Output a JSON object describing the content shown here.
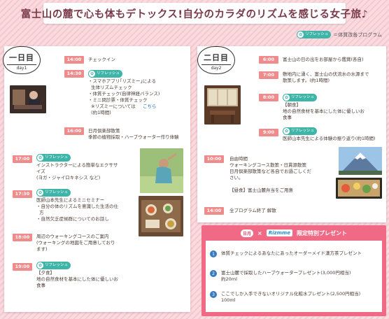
{
  "banner": {
    "title": "富士山の麓で心も体もデトックス!自分のカラダのリズムを感じる女子旅♪"
  },
  "legend": {
    "tag_text": "リフレッシュ",
    "text": "＝体質改善プログラム"
  },
  "colors": {
    "time_badge": "#f08b8b",
    "tag": "#3fb4a8",
    "present": "#f06a85",
    "link": "#1a6fc4"
  },
  "day1": {
    "badge": {
      "title": "一日目",
      "subtitle": "day1"
    },
    "items": [
      {
        "time": "14:00",
        "text": "チェックイン"
      },
      {
        "time": "14:30",
        "tag": "リフレッシュ",
        "text": "・スマホアプリ｢リズミー｣による\n  生体リズムチェック\n・体質チェック(自律神経バランス)\n・ミニ問診票・体質チェック\n  ※リズミーについては",
        "link": "こちら",
        "after": "  (約1時間)"
      },
      {
        "time": "16:00",
        "text": "日月倶楽部散策\n季節の植物採取・ハーブウォーター作り体験"
      },
      {
        "time": "17:00",
        "tag": "リフレッシュ",
        "text": "インストラクターによる簡単なエクササ\nイズ\n(ヨガ・ジャイロキネシス など)"
      },
      {
        "time": "17:30",
        "tag": "リフレッシュ",
        "text": "医師山本先生によるミニセミナー\n・自分の体のリズムを意識した生活の仕\n  方\n・自然欠乏症候群についてのお話し"
      },
      {
        "time": "18:00",
        "text": "周辺のウォーキングコースのご案内\n(ウォーキングの地図をご用意しており\nます)"
      },
      {
        "time": "19:00",
        "tag": "リフレッシュ",
        "text": "【夕食】\n地の自然食材を基本にした体に優しいお\n食事"
      }
    ]
  },
  "day2": {
    "badge": {
      "title": "二日目",
      "subtitle": "day2"
    },
    "items": [
      {
        "time": "6:00",
        "text": "富士山の日の出をお部屋から鑑賞(各自)"
      },
      {
        "time": "7:00",
        "text": "敷地内に湧く、富士山の伏流水の水源まで\n散策します。(約1時間)"
      },
      {
        "time": "8:00",
        "tag": "リフレッシュ",
        "text": "【朝食】\n地の自然食材を基本にした体に優しいお\n食事"
      },
      {
        "time": "9:00",
        "tag": "リフレッシュ",
        "text": "医師山本先生による体験の振り返り(約1時間)"
      },
      {
        "time": "10:00",
        "text": "自由時間\nウォーキングコース散策・日貫源散策\n日月倶楽部散策など各自でお過ごしくだ\nさい。\n\n【昼食】富士山麓弁当をご用意"
      },
      {
        "time": "14:00",
        "text": "全プログラム終了 解散"
      }
    ]
  },
  "present": {
    "logo_a": "日月",
    "cross": "×",
    "logo_b": "Rizmme",
    "title": "限定特別プレゼント",
    "items": [
      {
        "num": "1",
        "text": "体質チェックによるあなたにあったオーダーメイド漢方茶プレゼント"
      },
      {
        "num": "2",
        "text": "富士山麓で採取したハーブウォータープレゼント(3,000円相当)\n約20ml"
      },
      {
        "num": "3",
        "text": "ここでしか入手できないオリジナル化粧水プレゼント(2,500円相当)\n100ml"
      }
    ]
  }
}
